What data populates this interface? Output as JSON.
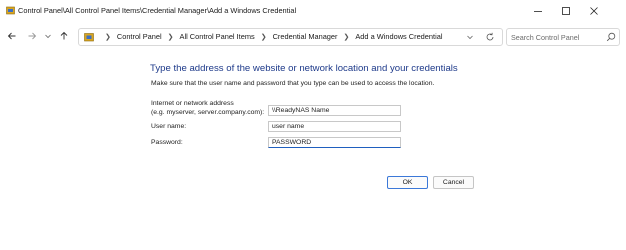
{
  "window": {
    "title": "Control Panel\\All Control Panel Items\\Credential Manager\\Add a Windows Credential"
  },
  "address": {
    "breadcrumbs": [
      "Control Panel",
      "All Control Panel Items",
      "Credential Manager",
      "Add a Windows Credential"
    ]
  },
  "search": {
    "placeholder": "Search Control Panel"
  },
  "form": {
    "heading": "Type the address of the website or network location and your credentials",
    "subheading": "Make sure that the user name and password that you type can be used to access the location.",
    "address_label_line1": "Internet or network address",
    "address_label_line2": "(e.g. myserver, server.company.com):",
    "address_value": "\\\\ReadyNAS Name",
    "username_label": "User name:",
    "username_value": "user name",
    "password_label": "Password:",
    "password_value": "PASSWORD"
  },
  "buttons": {
    "ok_label": "OK",
    "cancel_label": "Cancel"
  },
  "colors": {
    "heading": "#1e3a8a",
    "focus_accent": "#1f5fbf"
  }
}
